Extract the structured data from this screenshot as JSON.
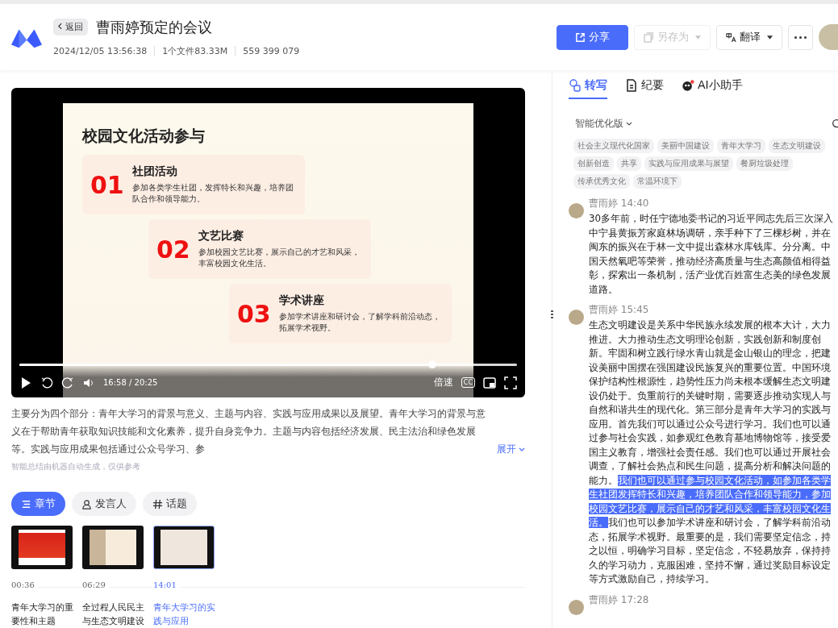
{
  "header": {
    "back_label": "返回",
    "title": "曹雨婷预定的会议",
    "meta": [
      "2024/12/05 13:56:38",
      "1个文件83.33M",
      "559 399 079"
    ],
    "actions": [
      {
        "kind": "primary",
        "label": "分享",
        "disabled": false
      },
      {
        "kind": "saveas",
        "label": "另存为",
        "disabled": true
      },
      {
        "kind": "translate",
        "label": "翻译",
        "disabled": false
      },
      {
        "kind": "more",
        "disabled": false
      }
    ]
  },
  "video": {
    "slide": {
      "title": "校园文化活动参与",
      "items": [
        {
          "number": "01",
          "title": "社团活动",
          "desc": "参加各类学生社团，发挥特长和兴趣，培养团队合作和领导能力。"
        },
        {
          "number": "02",
          "title": "文艺比赛",
          "desc": "参加校园文艺比赛，展示自己的才艺和风采，丰富校园文化生活。"
        },
        {
          "number": "03",
          "title": "学术讲座",
          "desc": "参加学术讲座和研讨会，了解学科前沿动态，拓展学术视野。"
        }
      ]
    },
    "progress": {
      "level": 0.83
    },
    "time": "16:58 / 20:25",
    "speed_label": "倍速",
    "cc_label": "CC"
  },
  "summary": {
    "text": "主要分为四个部分：青年大学习的背景与意义、主题与内容、实践与应用成果以及展望。青年大学习的背景与意义在于帮助青年获取知识技能和文化素养，提升自身竞争力。主题与内容包括经济发展、民主法治和绿色发展等。实践与应用成果包括通过公众号学习、参",
    "expand_label": "展开",
    "note": "智能总结由机器自动生成，仅供参考"
  },
  "view_tabs": [
    {
      "kind": "chapters",
      "label": "章节",
      "selected": true
    },
    {
      "kind": "speakers",
      "label": "发言人",
      "selected": false
    },
    {
      "kind": "topics",
      "label": "话题",
      "selected": false
    }
  ],
  "chapters": [
    {
      "kind": "red",
      "time": "00:36",
      "title": "青年大学习的重要性和主题",
      "selected": false
    },
    {
      "kind": "scroll",
      "time": "06:29",
      "title": "全过程人民民主与生态文明建设",
      "selected": false
    },
    {
      "kind": "slide",
      "time": "14:01",
      "title": "青年大学习的实践与应用",
      "selected": true
    }
  ],
  "panel_tabs": [
    {
      "kind": "transcript",
      "label": "转写",
      "selected": true
    },
    {
      "kind": "minutes",
      "label": "纪要",
      "selected": false
    },
    {
      "kind": "assistant",
      "label": "AI小助手",
      "selected": false
    }
  ],
  "version_label": "智能优化版",
  "tags": [
    "社会主义现代化国家",
    "美丽中国建设",
    "青年大学习",
    "生态文明建设",
    "创新创造",
    "共享",
    "实践与应用成果与展望",
    "餐厨垃圾处理",
    "传承优秀文化",
    "常温环境下"
  ],
  "transcript": [
    {
      "speaker": "曹雨婷",
      "time": "14:40",
      "segments": [
        {
          "text": "30多年前，时任宁德地委书记的习近平同志先后三次深入中宁县黄振芳家庭林场调研，亲手种下了三棵杉树，并在闽东的振兴在于林一文中提出森林水库钱库。分分离。中国天然氧吧等荣誉，推动经济高质量与生态高颜值相得益彰，探索出一条机制，活产业优百姓富生态美的绿色发展道路。",
          "highlighted": false
        }
      ]
    },
    {
      "speaker": "曹雨婷",
      "time": "15:45",
      "segments": [
        {
          "text": "生态文明建设是关系中华民族永续发展的根本大计，大力推进。大力推动生态文明理论创新，实践创新和制度创新。牢固和树立践行绿水青山就是金山银山的理念，把建设美丽中国摆在强国建设民族复兴的重要位置。中国环境保护结构性根源性，趋势性压力尚未根本缓解生态文明建设仍处于。负重前行的关键时期，需要逐步推动实现人与自然和谐共生的现代化。第三部分是青年大学习的实践与应用。首先我们可以通过公众号进行学习。我们也可以通过参与社会实践，如参观红色教育基地博物馆等，接受爱国主义教育，增强社会责任感。我们也可以通过开展社会调查，了解社会热点和民生问题，提高分析和解决问题的能力。",
          "highlighted": false
        },
        {
          "text": "我们也可以通过参与校园文化活动，如参加各类学生社团发挥特长和兴趣，培养团队合作和领导能力，参加校园文艺比赛，展示自己的才艺和风采，丰富校园文化生活。",
          "highlighted": true
        },
        {
          "text": "我们也可以参加学术讲座和研讨会，了解学科前沿动态，拓展学术视野。最重要的是，我们需要坚定信念，持之以恒，明确学习目标，坚定信念，不轻易放弃，保持持久的学习动力，克服困难，坚持不懈，通过奖励目标设定等方式激励自己，持续学习。",
          "highlighted": false
        }
      ]
    },
    {
      "speaker": "曹雨婷",
      "time": "17:28"
    }
  ]
}
